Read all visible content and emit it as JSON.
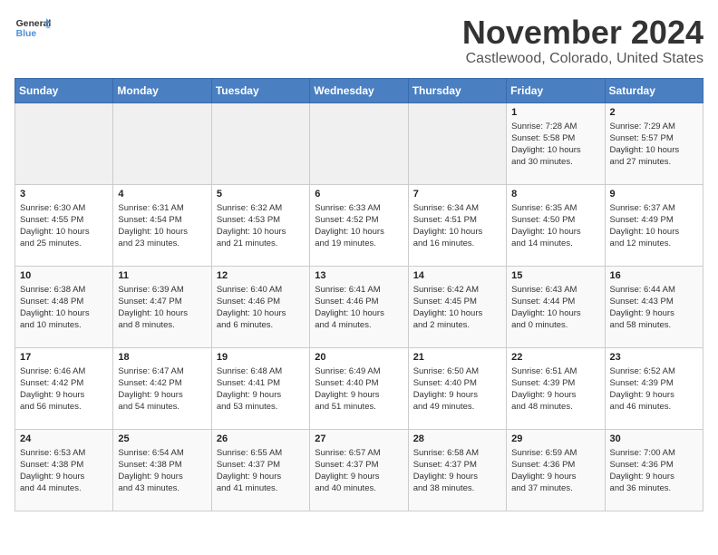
{
  "header": {
    "logo_general": "General",
    "logo_blue": "Blue",
    "title": "November 2024",
    "location": "Castlewood, Colorado, United States"
  },
  "weekdays": [
    "Sunday",
    "Monday",
    "Tuesday",
    "Wednesday",
    "Thursday",
    "Friday",
    "Saturday"
  ],
  "weeks": [
    [
      {
        "day": "",
        "info": ""
      },
      {
        "day": "",
        "info": ""
      },
      {
        "day": "",
        "info": ""
      },
      {
        "day": "",
        "info": ""
      },
      {
        "day": "",
        "info": ""
      },
      {
        "day": "1",
        "info": "Sunrise: 7:28 AM\nSunset: 5:58 PM\nDaylight: 10 hours\nand 30 minutes."
      },
      {
        "day": "2",
        "info": "Sunrise: 7:29 AM\nSunset: 5:57 PM\nDaylight: 10 hours\nand 27 minutes."
      }
    ],
    [
      {
        "day": "3",
        "info": "Sunrise: 6:30 AM\nSunset: 4:55 PM\nDaylight: 10 hours\nand 25 minutes."
      },
      {
        "day": "4",
        "info": "Sunrise: 6:31 AM\nSunset: 4:54 PM\nDaylight: 10 hours\nand 23 minutes."
      },
      {
        "day": "5",
        "info": "Sunrise: 6:32 AM\nSunset: 4:53 PM\nDaylight: 10 hours\nand 21 minutes."
      },
      {
        "day": "6",
        "info": "Sunrise: 6:33 AM\nSunset: 4:52 PM\nDaylight: 10 hours\nand 19 minutes."
      },
      {
        "day": "7",
        "info": "Sunrise: 6:34 AM\nSunset: 4:51 PM\nDaylight: 10 hours\nand 16 minutes."
      },
      {
        "day": "8",
        "info": "Sunrise: 6:35 AM\nSunset: 4:50 PM\nDaylight: 10 hours\nand 14 minutes."
      },
      {
        "day": "9",
        "info": "Sunrise: 6:37 AM\nSunset: 4:49 PM\nDaylight: 10 hours\nand 12 minutes."
      }
    ],
    [
      {
        "day": "10",
        "info": "Sunrise: 6:38 AM\nSunset: 4:48 PM\nDaylight: 10 hours\nand 10 minutes."
      },
      {
        "day": "11",
        "info": "Sunrise: 6:39 AM\nSunset: 4:47 PM\nDaylight: 10 hours\nand 8 minutes."
      },
      {
        "day": "12",
        "info": "Sunrise: 6:40 AM\nSunset: 4:46 PM\nDaylight: 10 hours\nand 6 minutes."
      },
      {
        "day": "13",
        "info": "Sunrise: 6:41 AM\nSunset: 4:46 PM\nDaylight: 10 hours\nand 4 minutes."
      },
      {
        "day": "14",
        "info": "Sunrise: 6:42 AM\nSunset: 4:45 PM\nDaylight: 10 hours\nand 2 minutes."
      },
      {
        "day": "15",
        "info": "Sunrise: 6:43 AM\nSunset: 4:44 PM\nDaylight: 10 hours\nand 0 minutes."
      },
      {
        "day": "16",
        "info": "Sunrise: 6:44 AM\nSunset: 4:43 PM\nDaylight: 9 hours\nand 58 minutes."
      }
    ],
    [
      {
        "day": "17",
        "info": "Sunrise: 6:46 AM\nSunset: 4:42 PM\nDaylight: 9 hours\nand 56 minutes."
      },
      {
        "day": "18",
        "info": "Sunrise: 6:47 AM\nSunset: 4:42 PM\nDaylight: 9 hours\nand 54 minutes."
      },
      {
        "day": "19",
        "info": "Sunrise: 6:48 AM\nSunset: 4:41 PM\nDaylight: 9 hours\nand 53 minutes."
      },
      {
        "day": "20",
        "info": "Sunrise: 6:49 AM\nSunset: 4:40 PM\nDaylight: 9 hours\nand 51 minutes."
      },
      {
        "day": "21",
        "info": "Sunrise: 6:50 AM\nSunset: 4:40 PM\nDaylight: 9 hours\nand 49 minutes."
      },
      {
        "day": "22",
        "info": "Sunrise: 6:51 AM\nSunset: 4:39 PM\nDaylight: 9 hours\nand 48 minutes."
      },
      {
        "day": "23",
        "info": "Sunrise: 6:52 AM\nSunset: 4:39 PM\nDaylight: 9 hours\nand 46 minutes."
      }
    ],
    [
      {
        "day": "24",
        "info": "Sunrise: 6:53 AM\nSunset: 4:38 PM\nDaylight: 9 hours\nand 44 minutes."
      },
      {
        "day": "25",
        "info": "Sunrise: 6:54 AM\nSunset: 4:38 PM\nDaylight: 9 hours\nand 43 minutes."
      },
      {
        "day": "26",
        "info": "Sunrise: 6:55 AM\nSunset: 4:37 PM\nDaylight: 9 hours\nand 41 minutes."
      },
      {
        "day": "27",
        "info": "Sunrise: 6:57 AM\nSunset: 4:37 PM\nDaylight: 9 hours\nand 40 minutes."
      },
      {
        "day": "28",
        "info": "Sunrise: 6:58 AM\nSunset: 4:37 PM\nDaylight: 9 hours\nand 38 minutes."
      },
      {
        "day": "29",
        "info": "Sunrise: 6:59 AM\nSunset: 4:36 PM\nDaylight: 9 hours\nand 37 minutes."
      },
      {
        "day": "30",
        "info": "Sunrise: 7:00 AM\nSunset: 4:36 PM\nDaylight: 9 hours\nand 36 minutes."
      }
    ]
  ]
}
